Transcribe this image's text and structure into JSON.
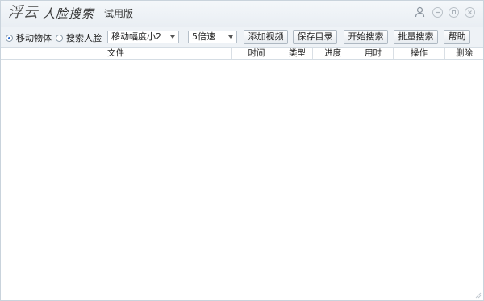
{
  "window": {
    "brand_part1": "浮云",
    "brand_part2": "人脸搜索",
    "edition": "试用版"
  },
  "toolbar": {
    "mode_options": [
      {
        "label": "移动物体",
        "selected": true
      },
      {
        "label": "搜索人脸",
        "selected": false
      }
    ],
    "motion_select": {
      "value": "移动幅度小2"
    },
    "speed_select": {
      "value": "5倍速"
    },
    "add_video": "添加视频",
    "save_dir": "保存目录",
    "start_search": "开始搜索",
    "batch_search": "批量搜索",
    "help": "帮助"
  },
  "table": {
    "headers": {
      "file": "文件",
      "time": "时间",
      "type": "类型",
      "progress": "进度",
      "duration": "用时",
      "action": "操作",
      "delete": "删除"
    },
    "rows": []
  },
  "colors": {
    "accent": "#2b6bd1",
    "titlebar": "#eef2f6",
    "border": "#c9d3dc"
  },
  "icons": {
    "user": "user-icon",
    "minimize": "minimize-icon",
    "maximize": "maximize-icon",
    "close": "close-icon"
  }
}
